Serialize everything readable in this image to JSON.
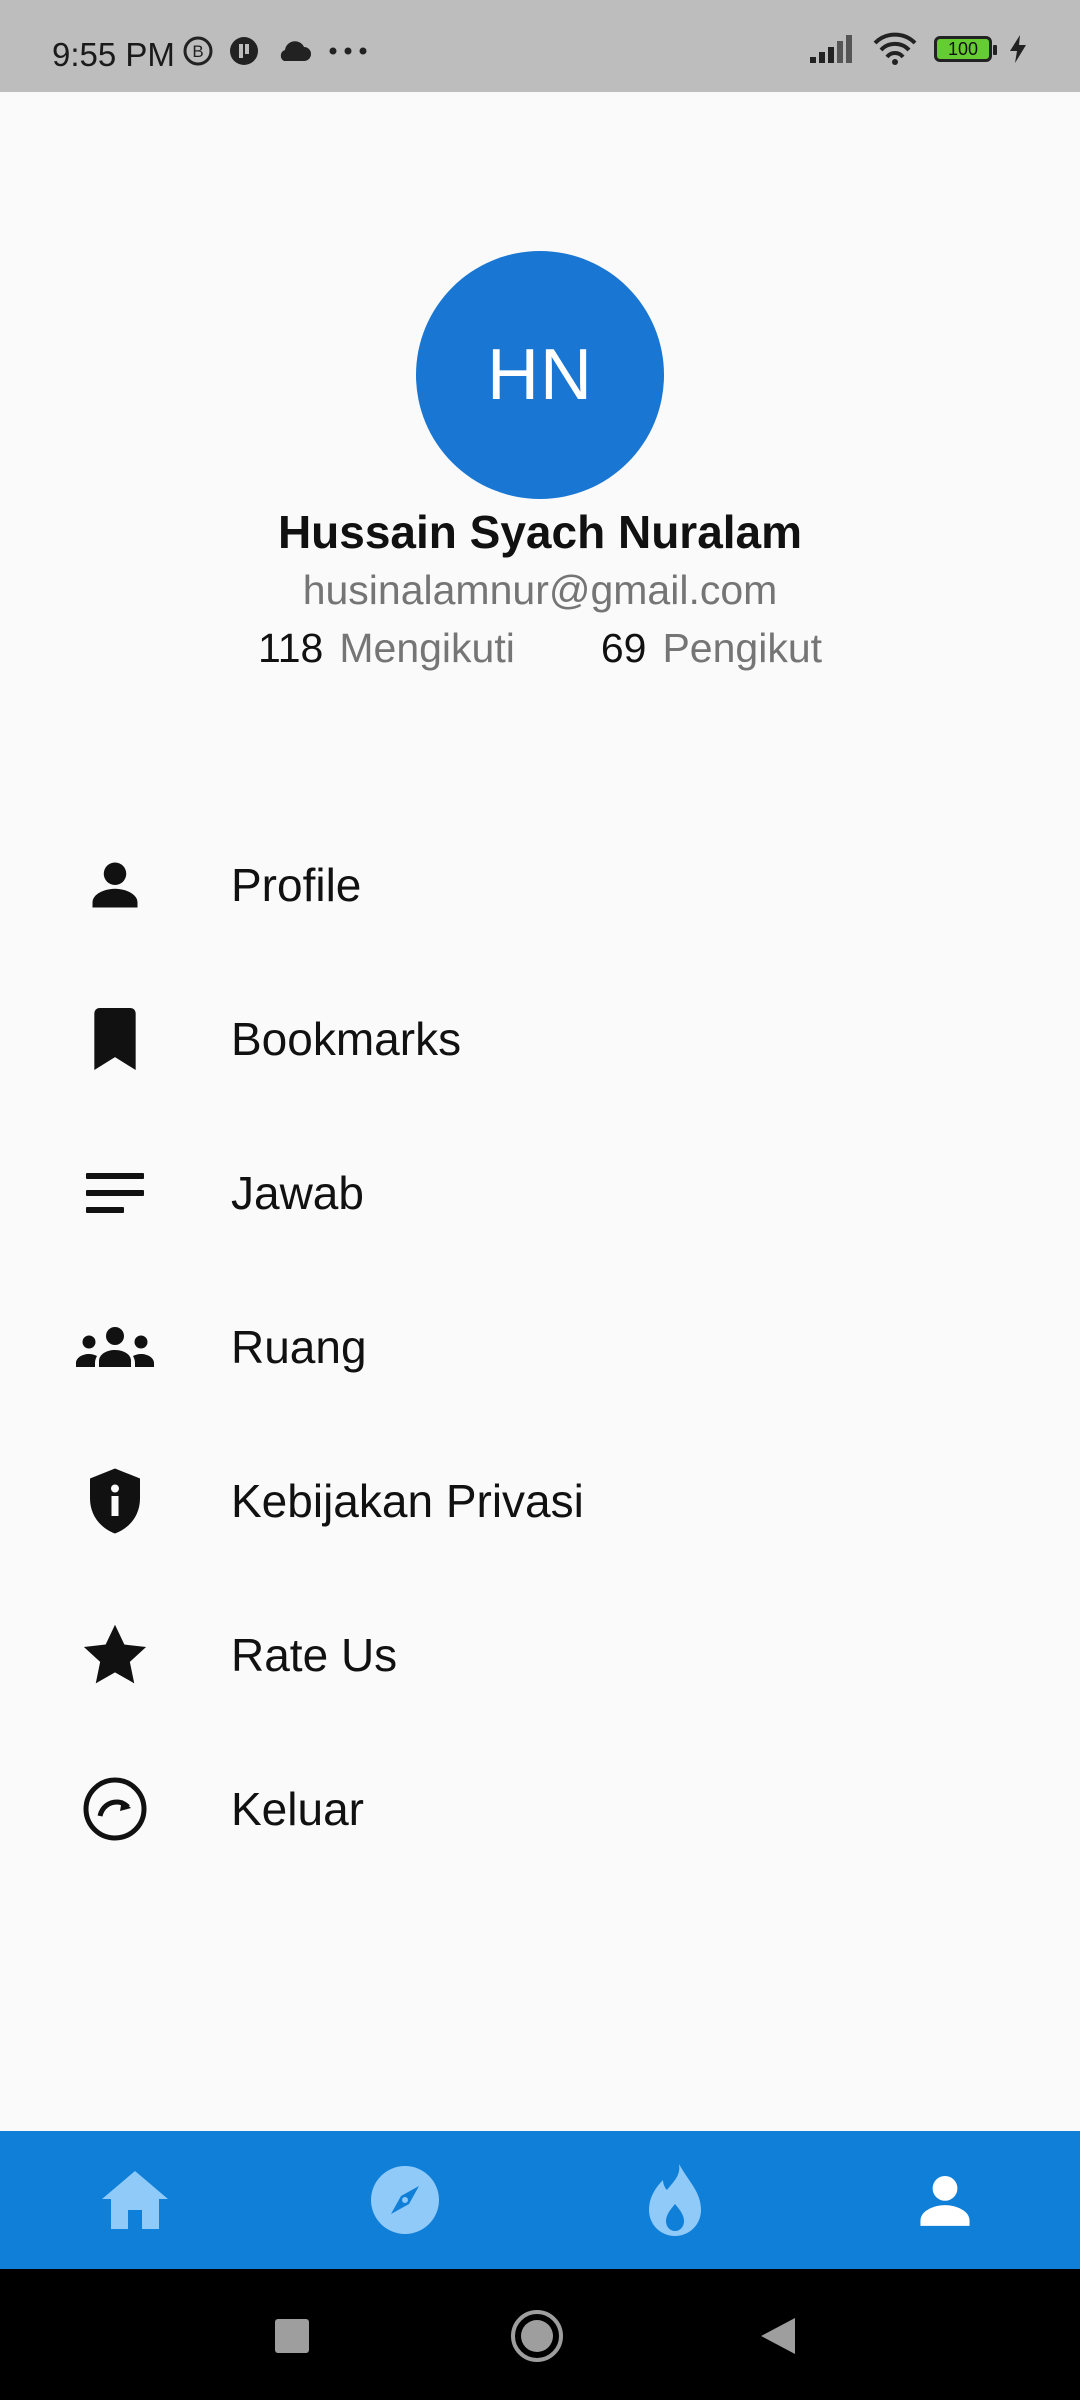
{
  "status_bar": {
    "time": "9:55 PM",
    "battery": "100",
    "left_icons": [
      "b-badge-icon",
      "pause-circle-icon",
      "cloud-icon",
      "more-dots-icon"
    ],
    "right_icons": [
      "signal-icon",
      "wifi-icon",
      "battery-icon",
      "charging-icon"
    ]
  },
  "profile": {
    "initials": "HN",
    "name": "Hussain Syach Nuralam",
    "email": "husinalamnur@gmail.com",
    "following_count": "118",
    "following_label": "Mengikuti",
    "followers_count": "69",
    "followers_label": "Pengikut"
  },
  "menu": {
    "items": [
      {
        "label": "Profile",
        "icon": "person-icon"
      },
      {
        "label": "Bookmarks",
        "icon": "bookmark-icon"
      },
      {
        "label": "Jawab",
        "icon": "lines-icon"
      },
      {
        "label": "Ruang",
        "icon": "group-icon"
      },
      {
        "label": "Kebijakan Privasi",
        "icon": "shield-info-icon"
      },
      {
        "label": "Rate Us",
        "icon": "star-icon"
      },
      {
        "label": "Keluar",
        "icon": "logout-circle-icon"
      }
    ]
  },
  "bottom_nav": {
    "items": [
      "home-icon",
      "compass-icon",
      "fire-icon",
      "person-icon"
    ],
    "active_index": 3,
    "colors": {
      "background": "#0f7fd8",
      "inactive": "#90caf9",
      "active": "#ffffff"
    }
  },
  "colors": {
    "avatar": "#1976d2",
    "secondary_text": "#757575",
    "background": "#fafafa"
  }
}
